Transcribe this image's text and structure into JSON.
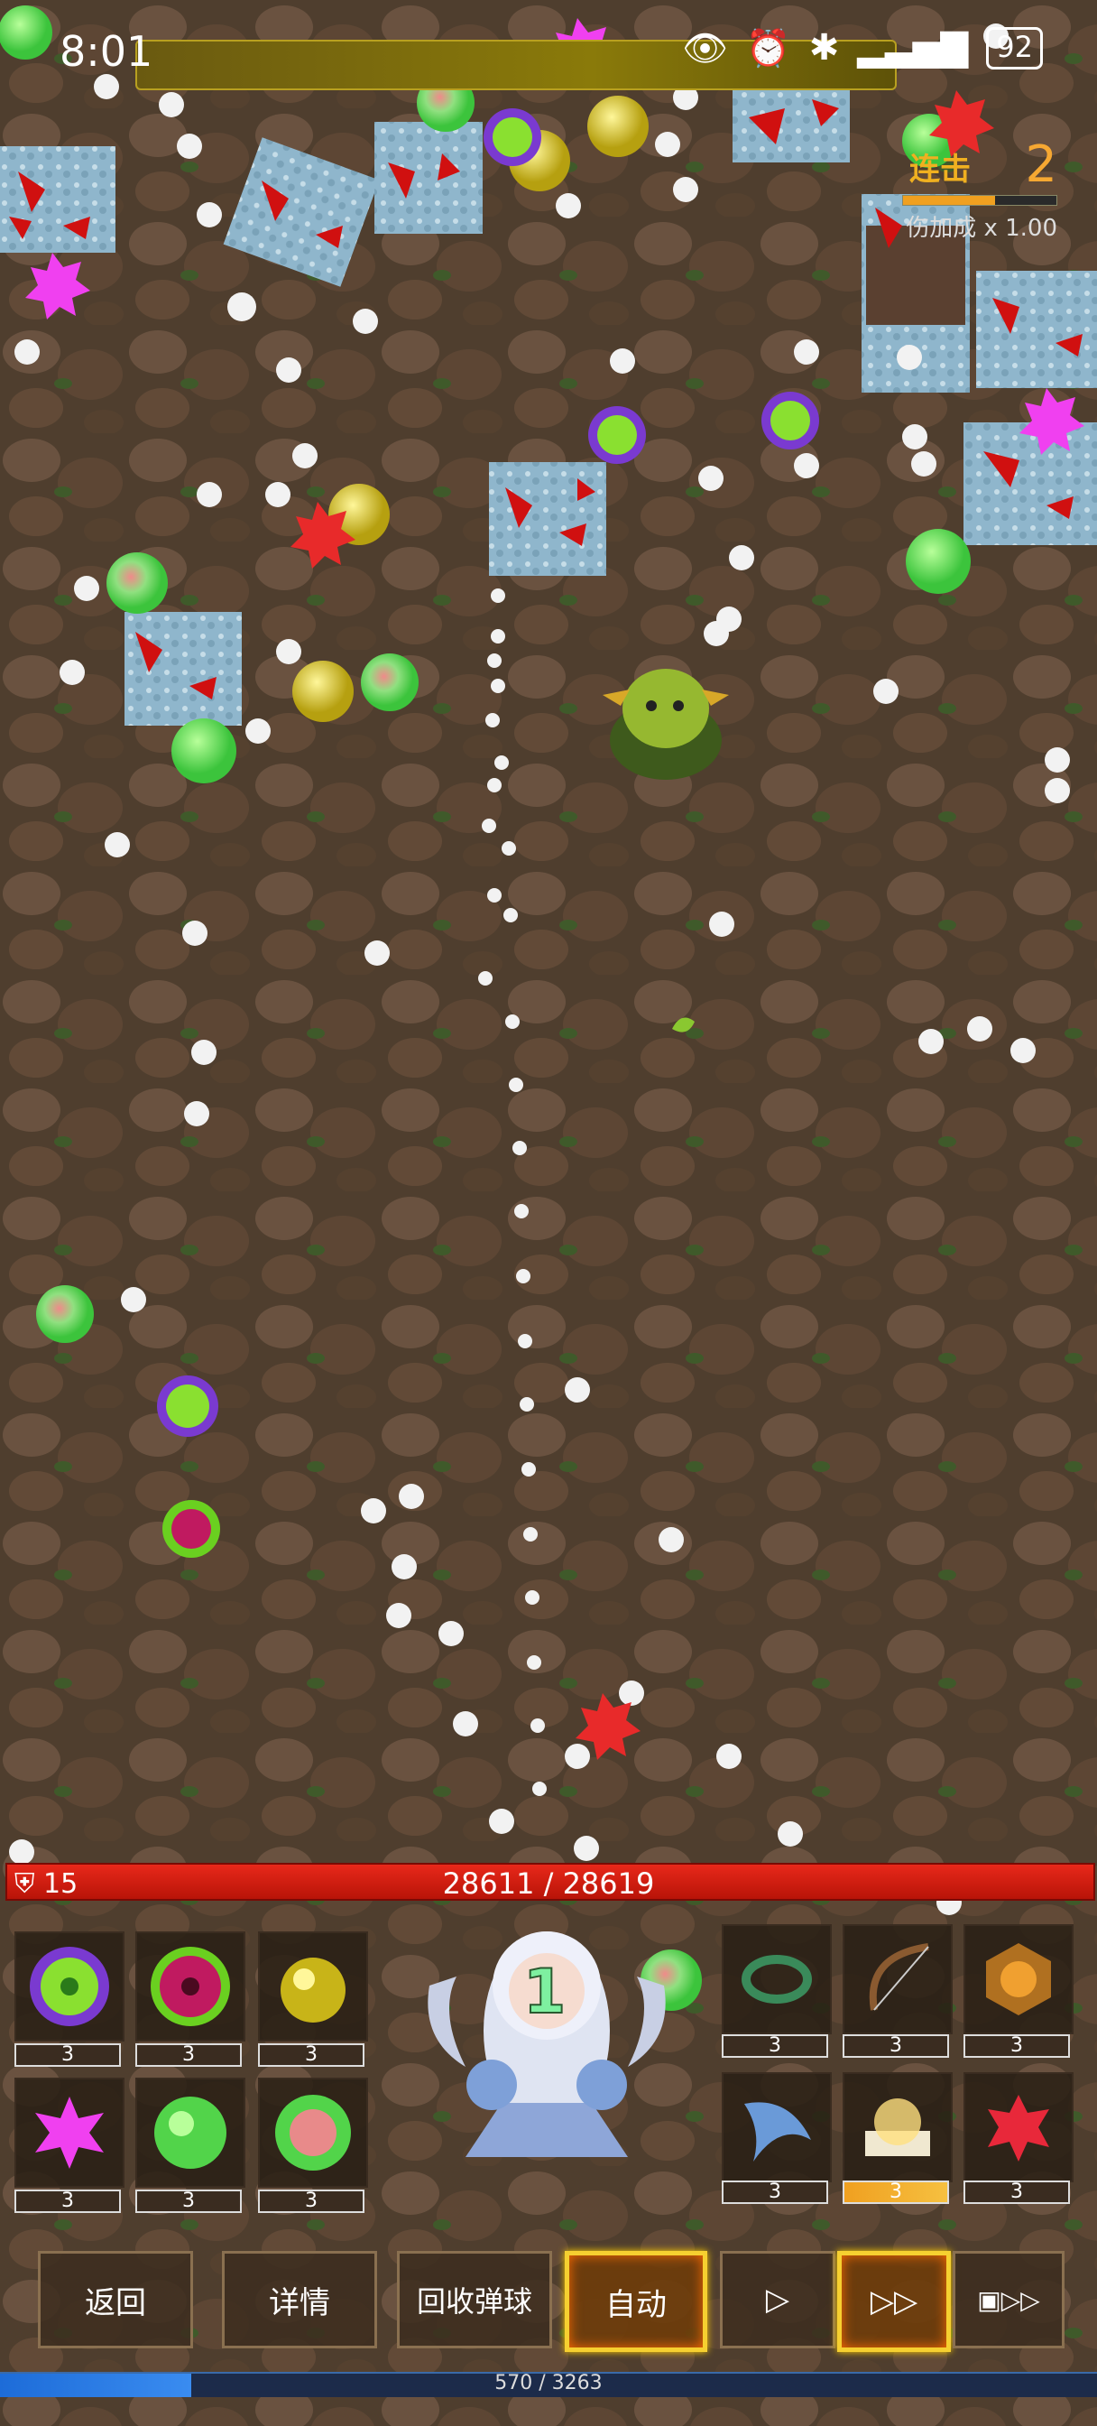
{
  "status_bar": {
    "time": "8:01",
    "battery": "92"
  },
  "combo": {
    "label": "连击",
    "count": "2",
    "bonus": "伤加成 x 1.00",
    "progress": 0.6
  },
  "hp": {
    "shield": "15",
    "text": "28611 / 28619",
    "current": 28611,
    "max": 28619
  },
  "hero": {
    "count": "1"
  },
  "left_slots": [
    {
      "icon": "purple-vortex-ball-icon",
      "count": "3"
    },
    {
      "icon": "red-vortex-ball-icon",
      "count": "3"
    },
    {
      "icon": "yellow-ball-icon",
      "count": "3"
    },
    {
      "icon": "magenta-star-icon",
      "count": "3"
    },
    {
      "icon": "green-ball-icon",
      "count": "3"
    },
    {
      "icon": "green-pink-ball-icon",
      "count": "3"
    }
  ],
  "right_slots": [
    {
      "icon": "green-wreath-icon",
      "count": "3"
    },
    {
      "icon": "bow-icon",
      "count": "3"
    },
    {
      "icon": "amber-gem-icon",
      "count": "3"
    },
    {
      "icon": "blue-wing-icon",
      "count": "3"
    },
    {
      "icon": "glowing-book-icon",
      "count": "3",
      "highlight": true
    },
    {
      "icon": "red-star-icon",
      "count": "3"
    }
  ],
  "buttons": {
    "back": "返回",
    "details": "详情",
    "recycle": "回收弹球",
    "auto": "自动"
  },
  "exp": {
    "text": "570 / 3263",
    "current": 570,
    "max": 3263
  }
}
